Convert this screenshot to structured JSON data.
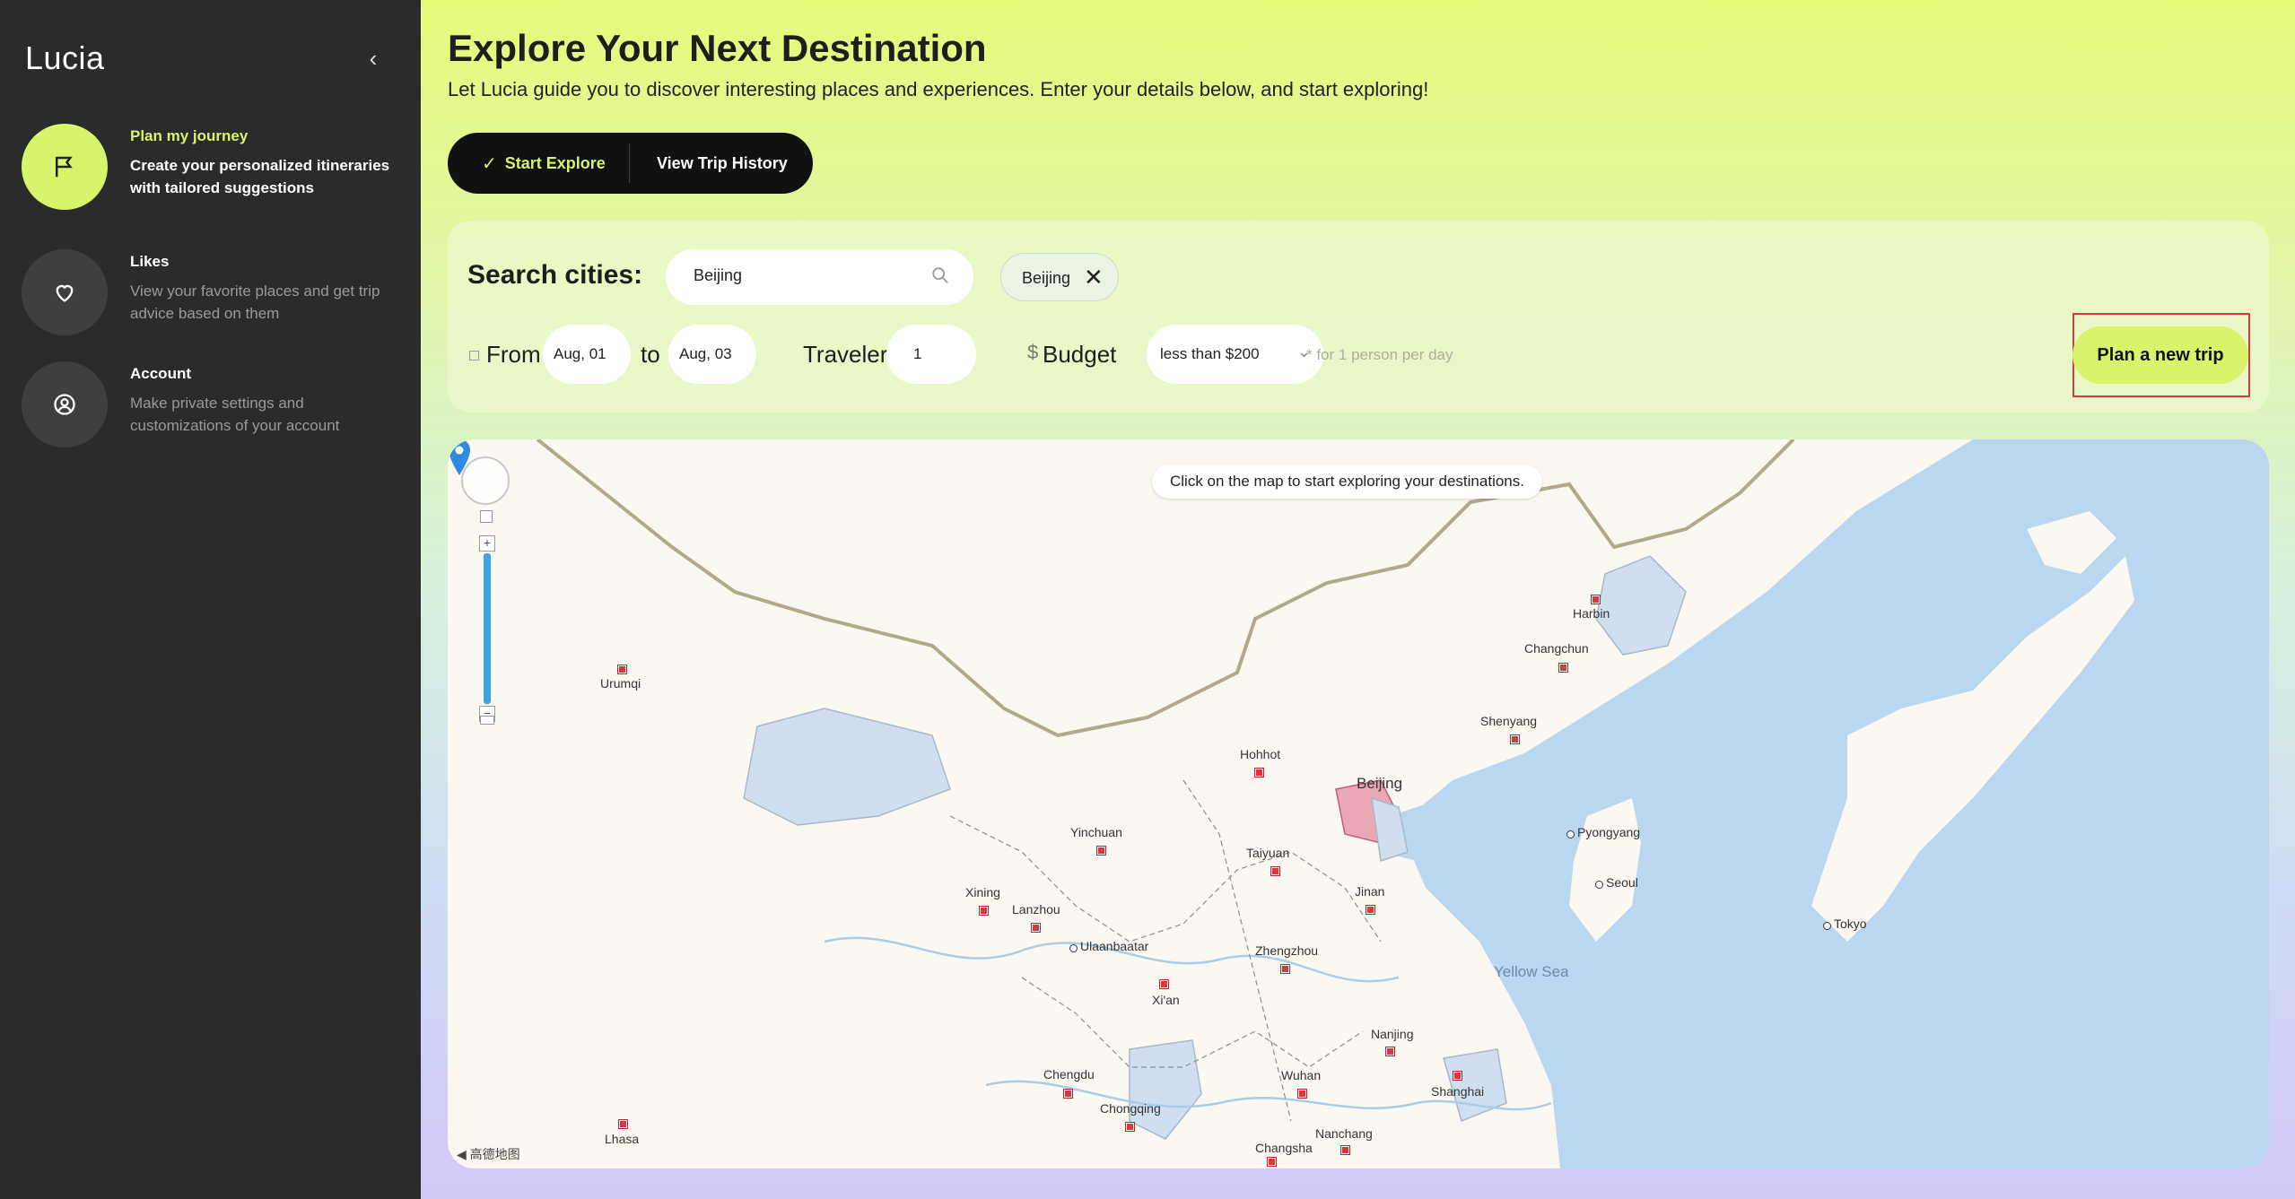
{
  "sidebar": {
    "brand": "Lucia",
    "collapse_icon": "chevron-left-icon",
    "items": [
      {
        "title": "Plan my journey",
        "desc": "Create your personalized itineraries with tailored suggestions",
        "icon": "flag-icon",
        "active": true
      },
      {
        "title": "Likes",
        "desc": "View your favorite places and get trip advice based on them",
        "icon": "heart-icon",
        "active": false
      },
      {
        "title": "Account",
        "desc": "Make private settings and customizations of your account",
        "icon": "user-circle-icon",
        "active": false
      }
    ]
  },
  "header": {
    "title": "Explore Your Next Destination",
    "subtitle": "Let Lucia guide you to discover interesting places and experiences. Enter your details below, and start exploring!"
  },
  "tabs": {
    "start_explore": "Start Explore",
    "view_history": "View Trip History"
  },
  "search": {
    "label": "Search cities:",
    "value": "Beijing",
    "selected_chip": "Beijing"
  },
  "trip": {
    "from_label": "From",
    "from_date": "Aug, 01",
    "to_label": "to",
    "to_date": "Aug, 03",
    "traveler_label": "Traveler",
    "traveler_count": "1",
    "budget_symbol": "$",
    "budget_label": "Budget",
    "budget_value": "less than $200",
    "budget_note": "* for 1 person per day",
    "plan_button": "Plan a new trip"
  },
  "map": {
    "hint": "Click on the map to start exploring your destinations.",
    "provider_logo": "高德地图",
    "capitals": [
      "Ulaanbaatar",
      "Pyongyang",
      "Seoul",
      "Tokyo"
    ],
    "cities": [
      "Harbin",
      "Changchun",
      "Shenyang",
      "Urumqi",
      "Hohhot",
      "Beijing",
      "Yinchuan",
      "Taiyuan",
      "Jinan",
      "Xining",
      "Lanzhou",
      "Zhengzhou",
      "Xi'an",
      "Nanjing",
      "Shanghai",
      "Wuhan",
      "Chengdu",
      "Chongqing",
      "Lhasa",
      "Changsha",
      "Nanchang"
    ],
    "sea": "Yellow Sea",
    "colors": {
      "water": "#b9d7f0",
      "land": "#fbf8f1",
      "highlight": "#cfdff0",
      "pin": "#2f8ae0"
    }
  },
  "colors": {
    "accent": "#d7f46a",
    "sidebar_bg": "#2b2b2b"
  }
}
